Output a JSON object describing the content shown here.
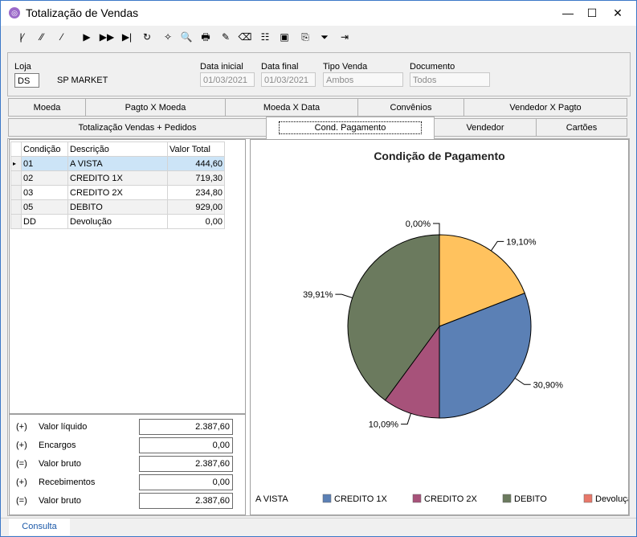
{
  "window": {
    "title": "Totalização de Vendas",
    "minimize_glyph": "—",
    "maximize_glyph": "☐",
    "close_glyph": "✕"
  },
  "toolbar": {
    "icons": [
      "first-record-icon",
      "prev-page-icon",
      "prev-record-icon",
      "next-record-icon",
      "next-page-icon",
      "last-record-icon",
      "refresh-icon",
      "wand-icon",
      "print-preview-icon",
      "print-icon",
      "export-icon",
      "clear-icon",
      "filter-icon",
      "screenshot-icon",
      "save-icon",
      "funnel-icon",
      "exit-icon"
    ],
    "glyphs": [
      "|⁄",
      "⁄⁄",
      "⁄",
      "▶",
      "▶▶",
      "▶|",
      "↻",
      "✧",
      "🔍",
      "🖶",
      "✎",
      "⌫",
      "☷",
      "▣",
      "⎘",
      "⏷",
      "⇥"
    ]
  },
  "filters": {
    "loja_label": "Loja",
    "loja_code": "DS",
    "loja_name": "SP MARKET",
    "data_inicial_label": "Data inicial",
    "data_inicial": "01/03/2021",
    "data_final_label": "Data final",
    "data_final": "01/03/2021",
    "tipo_venda_label": "Tipo Venda",
    "tipo_venda": "Ambos",
    "documento_label": "Documento",
    "documento": "Todos"
  },
  "tabs_top": [
    "Moeda",
    "Pagto X Moeda",
    "Moeda X Data",
    "Convênios",
    "Vendedor X Pagto"
  ],
  "tabs_bottom": [
    "Totalização Vendas + Pedidos",
    "Cond. Pagamento",
    "Vendedor",
    "Cartões"
  ],
  "grid": {
    "columns": [
      "Condição",
      "Descrição",
      "Valor Total"
    ],
    "rows": [
      {
        "cond": "01",
        "desc": "A VISTA",
        "valor": "444,60"
      },
      {
        "cond": "02",
        "desc": "CREDITO 1X",
        "valor": "719,30"
      },
      {
        "cond": "03",
        "desc": "CREDITO 2X",
        "valor": "234,80"
      },
      {
        "cond": "05",
        "desc": "DEBITO",
        "valor": "929,00"
      },
      {
        "cond": "DD",
        "desc": "Devolução",
        "valor": "0,00"
      }
    ]
  },
  "summary": [
    {
      "sign": "(+)",
      "label": "Valor líquido",
      "value": "2.387,60"
    },
    {
      "sign": "(+)",
      "label": "Encargos",
      "value": "0,00"
    },
    {
      "sign": "(=)",
      "label": "Valor bruto",
      "value": "2.387,60"
    },
    {
      "sign": "(+)",
      "label": "Recebimentos",
      "value": "0,00"
    },
    {
      "sign": "(=)",
      "label": "Valor bruto",
      "value": "2.387,60"
    }
  ],
  "chart_data": {
    "type": "pie",
    "title": "Condição de Pagamento",
    "slices": [
      {
        "name": "A VISTA",
        "value": 19.1,
        "label": "19,10%",
        "color": "#FFC25E"
      },
      {
        "name": "CREDITO 1X",
        "value": 30.9,
        "label": "30,90%",
        "color": "#5B80B5"
      },
      {
        "name": "CREDITO 2X",
        "value": 10.09,
        "label": "10,09%",
        "color": "#A7527A"
      },
      {
        "name": "DEBITO",
        "value": 39.91,
        "label": "39,91%",
        "color": "#6B7A5E"
      },
      {
        "name": "Devolução",
        "value": 0.0,
        "label": "0,00%",
        "color": "#E8786A"
      }
    ],
    "legend_position": "bottom"
  },
  "statusbar": {
    "tab": "Consulta"
  }
}
